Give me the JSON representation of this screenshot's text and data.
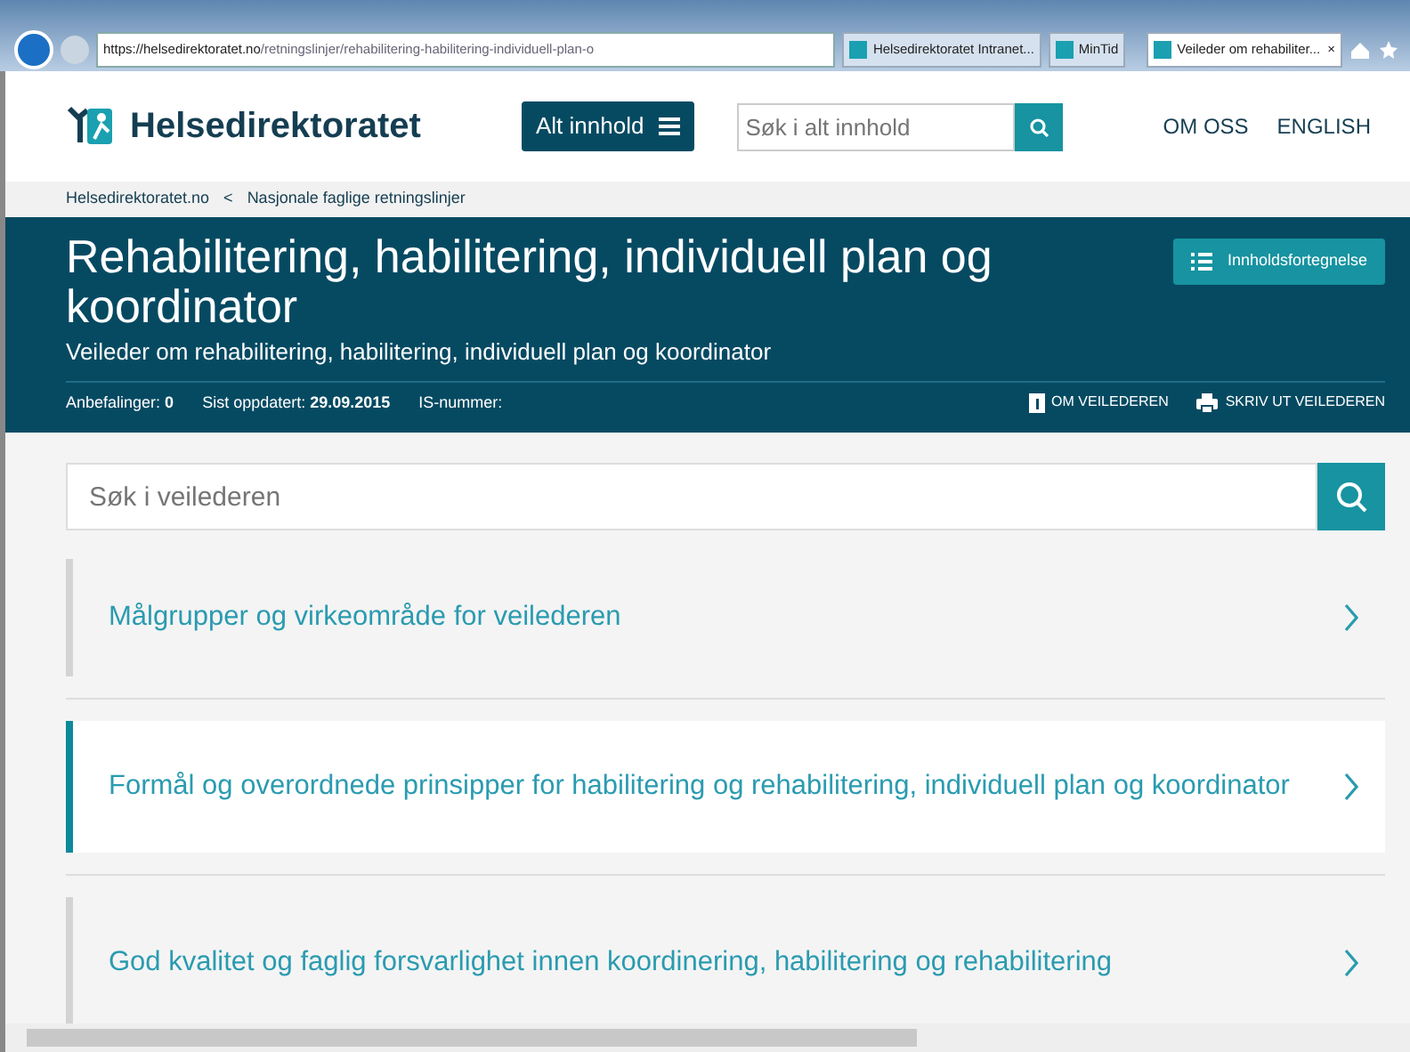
{
  "browser": {
    "url": {
      "host": "https://helsedirektoratet.no",
      "path": "/retningslinjer/rehabilitering-habilitering-individuell-plan-o"
    },
    "tabs": [
      {
        "label": "Helsedirektoratet Intranet...",
        "selected": false,
        "closable": false
      },
      {
        "label": "MinTid",
        "selected": false,
        "closable": false
      },
      {
        "label": "Veileder om rehabiliter...",
        "selected": true,
        "closable": true
      }
    ],
    "close_glyph": "×"
  },
  "header": {
    "logo_text": "Helsedirektoratet",
    "menu_button": "Alt innhold",
    "search": {
      "placeholder": "Søk i alt innhold"
    },
    "links": [
      "OM OSS",
      "ENGLISH"
    ]
  },
  "breadcrumb": {
    "items": [
      "Helsedirektoratet.no",
      "Nasjonale faglige retningslinjer"
    ],
    "separator": "<"
  },
  "banner": {
    "title": "Rehabilitering, habilitering, individuell plan og koordinator",
    "subtitle": "Veileder om rehabilitering, habilitering, individuell plan og koordinator",
    "toc_button": "Innholdsfortegnelse",
    "meta": [
      {
        "label": "Anbefalinger:",
        "value": "0"
      },
      {
        "label": "Sist oppdatert:",
        "value": "29.09.2015"
      },
      {
        "label": "IS-nummer:"
      }
    ],
    "actions": [
      {
        "kind": "info",
        "label": "OM VEILEDEREN"
      },
      {
        "kind": "print",
        "label": "SKRIV UT VEILEDEREN"
      }
    ]
  },
  "guide_search": {
    "placeholder": "Søk i veilederen"
  },
  "chapters": [
    {
      "title": "Målgrupper og virkeområde for veilederen",
      "selected": false
    },
    {
      "title": "Formål og overordnede prinsipper for habilitering og rehabilitering, individuell plan og koordinator",
      "selected": true
    },
    {
      "title": "God kvalitet og faglig forsvarlighet innen koordinering, habilitering og rehabilitering",
      "selected": false
    }
  ]
}
